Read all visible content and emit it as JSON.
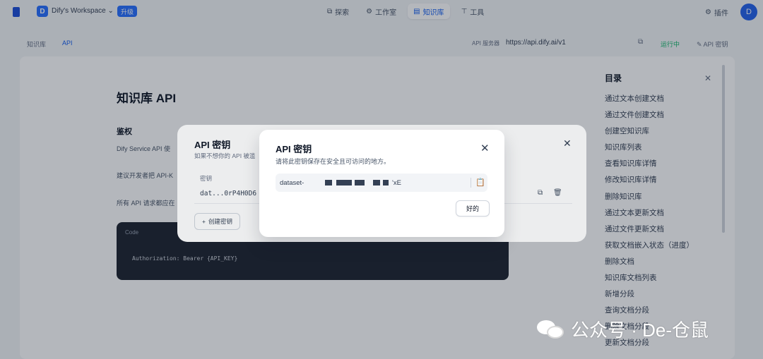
{
  "topbar": {
    "workspace_avatar": "D",
    "workspace_name": "Dify's Workspace ⌄",
    "upgrade": "升级",
    "nav": [
      {
        "icon": "explore-icon",
        "glyph": "⧉",
        "label": "探索"
      },
      {
        "icon": "studio-icon",
        "glyph": "⚙",
        "label": "工作室"
      },
      {
        "icon": "knowledge-icon",
        "glyph": "▤",
        "label": "知识库"
      },
      {
        "icon": "tools-icon",
        "glyph": "⊤",
        "label": "工具"
      }
    ],
    "plugins_label": "插件",
    "user_avatar": "D"
  },
  "subbar": {
    "breadcrumb_1": "知识库",
    "breadcrumb_2": "API",
    "api_server_label": "API 服务器",
    "api_url": "https://api.dify.ai/v1",
    "status": "运行中",
    "api_key_button": "✎ API 密钥"
  },
  "doc": {
    "title": "知识库 API",
    "auth_heading": "鉴权",
    "para1": "Dify Service API 使",
    "para2": "建议开发者把 API-K",
    "para3": "所有 API 请求都应在",
    "code_label": "Code",
    "code_text": "Authorization: Bearer {API_KEY}"
  },
  "toc": {
    "title": "目录",
    "items": [
      "通过文本创建文档",
      "通过文件创建文档",
      "创建空知识库",
      "知识库列表",
      "查看知识库详情",
      "修改知识库详情",
      "删除知识库",
      "通过文本更新文档",
      "通过文件更新文档",
      "获取文档嵌入状态（进度）",
      "删除文档",
      "知识库文档列表",
      "新增分段",
      "查询文档分段",
      "删除文档分段",
      "更新文档分段"
    ]
  },
  "back_modal": {
    "title": "API 密钥",
    "desc": "如果不想你的 API 被滥",
    "column_key": "密钥",
    "key_value": "dat...0rP4H0D6",
    "create_button": "创建密钥"
  },
  "modal": {
    "title": "API 密钥",
    "desc": "请将此密钥保存在安全且可访问的地方。",
    "key_prefix": "dataset-",
    "key_suffix": "'xE",
    "ok_button": "好的"
  },
  "watermark": {
    "text": "公众号 · De-仓鼠"
  }
}
